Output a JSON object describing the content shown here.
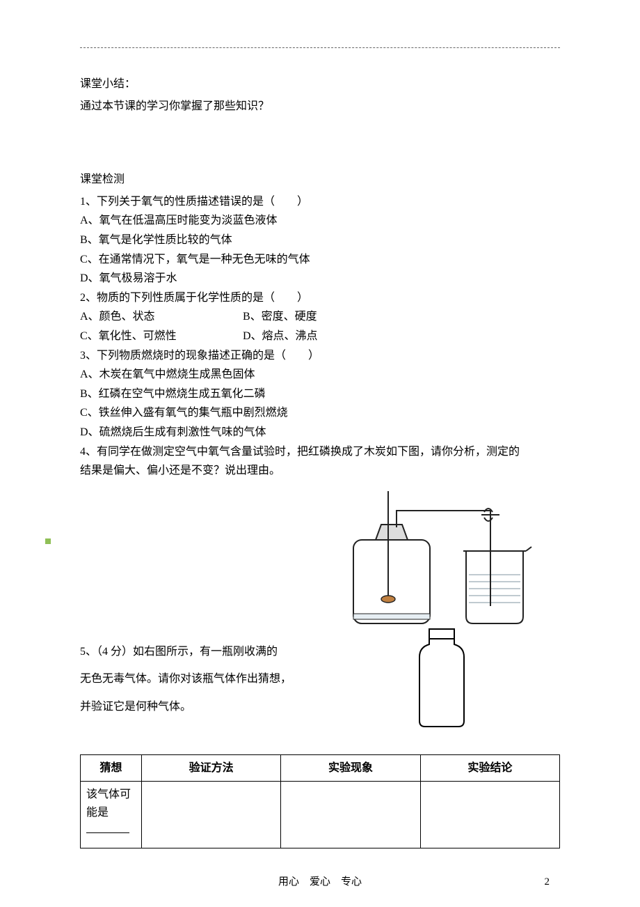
{
  "summary": {
    "heading": "课堂小结：",
    "prompt": "通过本节课的学习你掌握了那些知识？"
  },
  "test": {
    "heading": "课堂检测",
    "q1": {
      "stem": "1、下列关于氧气的性质描述错误的是（　　）",
      "a": "A、氧气在低温高压时能变为淡蓝色液体",
      "b": "B、氧气是化学性质比较的气体",
      "c": "C、在通常情况下，氧气是一种无色无味的气体",
      "d": "D、氧气极易溶于水"
    },
    "q2": {
      "stem": "2、物质的下列性质属于化学性质的是（　　）",
      "a": "A、颜色、状态",
      "b": "B、密度、硬度",
      "c": "C、氧化性、可燃性",
      "d": "D、熔点、沸点"
    },
    "q3": {
      "stem": "3、下列物质燃烧时的现象描述正确的是（　　）",
      "a": "A、木炭在氧气中燃烧生成黑色固体",
      "b": "B、红磷在空气中燃烧生成五氧化二磷",
      "c": "C、铁丝伸入盛有氧气的集气瓶中剧烈燃烧",
      "d": "D、硫燃烧后生成有刺激性气味的气体"
    },
    "q4": {
      "line1": "4、有同学在做测定空气中氧气含量试验时，把红磷换成了木炭如下图，请你分析，测定的",
      "line2": "结果是偏大、偏小还是不变？说出理由。"
    },
    "q5": {
      "line1": "5、（4 分）如右图所示，有一瓶刚收满的",
      "line2": "无色无毒气体。请你对该瓶气体作出猜想，",
      "line3": "并验证它是何种气体。"
    },
    "table": {
      "h1": "猜想",
      "h2": "验证方法",
      "h3": "实验现象",
      "h4": "实验结论",
      "r1_prefix": "该气体可能是"
    }
  },
  "footer": {
    "motto": "用心　爱心　专心",
    "page": "2"
  }
}
